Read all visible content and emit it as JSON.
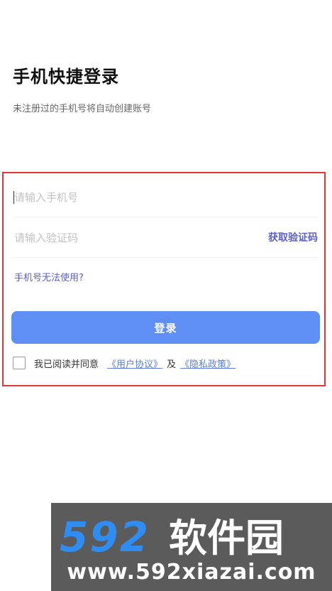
{
  "header": {
    "title": "手机快捷登录",
    "subtitle": "未注册过的手机号将自动创建账号"
  },
  "form": {
    "phone_placeholder": "请输入手机号",
    "phone_value": "",
    "code_placeholder": "请输入验证码",
    "code_value": "",
    "get_code_label": "获取验证码",
    "phone_issue_link": "手机号无法使用?",
    "login_label": "登录"
  },
  "agreement": {
    "checked": false,
    "prefix": "我已阅读并同意",
    "user_agreement": "《用户协议》",
    "conjunction": "及",
    "privacy_policy": "《隐私政策》"
  },
  "watermark": {
    "brand": "592软件园",
    "url": "www.592xiazai.com"
  },
  "colors": {
    "accent": "#5b5fc7",
    "login_button": "#5f8ff5",
    "link": "#5b7fd6",
    "highlight_border": "#e0353a"
  }
}
